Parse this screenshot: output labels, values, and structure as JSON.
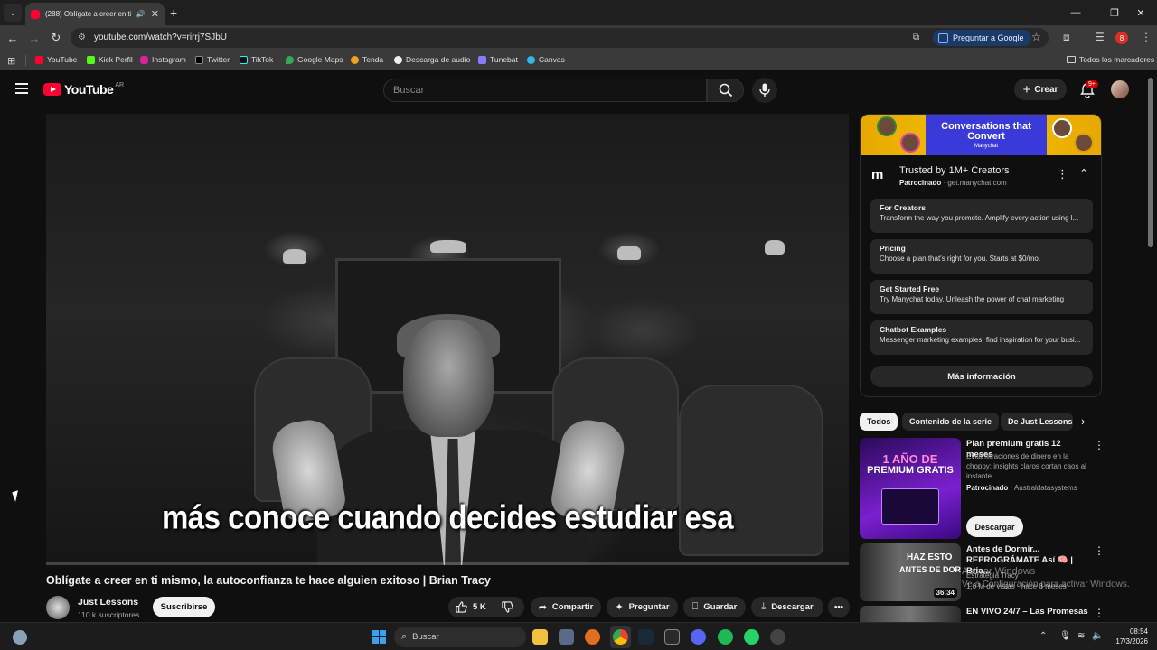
{
  "browser": {
    "tab_title": "(288) Oblígate a creer en ti",
    "url": "youtube.com/watch?v=rirrj7SJbU",
    "ask_google": "Preguntar a Google",
    "profile_initial": "8",
    "bookmarks": [
      "YouTube",
      "Kick Perfil",
      "Instagram",
      "Twitter",
      "TikTok",
      "Google Maps",
      "Tenda",
      "Descarga de audio",
      "Tunebat",
      "Canvas"
    ],
    "all_bookmarks": "Todos los marcadores"
  },
  "youtube": {
    "logo_text": "YouTube",
    "region": "AR",
    "search_placeholder": "Buscar",
    "create_label": "Crear",
    "notifications_badge": "9+",
    "brand_color": "#ff0033"
  },
  "video": {
    "caption": "más conoce cuando decides estudiar esa",
    "title": "Oblígate a creer en ti mismo, la autoconfianza te hace alguien exitoso | Brian Tracy",
    "progress_fraction": 0.0,
    "channel": {
      "name": "Just Lessons",
      "subscribers": "110 k suscriptores",
      "subscribe_label": "Suscribirse"
    },
    "actions": {
      "likes": "5 K",
      "share": "Compartir",
      "ask": "Preguntar",
      "save": "Guardar",
      "download": "Descargar"
    }
  },
  "ad": {
    "banner_title": "Conversations that Convert",
    "banner_brand": "Manychat",
    "title": "Trusted by 1M+ Creators",
    "sponsored": "Patrocinado",
    "domain": "get.manychat.com",
    "links": [
      {
        "title": "For Creators",
        "desc": "Transform the way you promote. Amplify every action using l..."
      },
      {
        "title": "Pricing",
        "desc": "Choose a plan that's right for you. Starts at $0/mo."
      },
      {
        "title": "Get Started Free",
        "desc": "Try Manychat today. Unleash the power of chat marketing"
      },
      {
        "title": "Chatbot Examples",
        "desc": "Messenger marketing examples. find inspiration for your busi..."
      }
    ],
    "cta": "Más información"
  },
  "chips": [
    "Todos",
    "Contenido de la serie",
    "De Just Lessons"
  ],
  "recommended": [
    {
      "title": "Plan premium gratis 12 meses",
      "desc": "Evita filtraciones de dinero en la choppy; insights claros cortan caos al instante.",
      "sponsored": "Patrocinado",
      "advertiser": "Australdatasystems",
      "thumb_line1": "1 AÑO DE",
      "thumb_line2": "PREMIUM GRATIS",
      "download_label": "Descargar"
    },
    {
      "title": "Antes de Dormir... REPROGRÁMATE Así 🧠 | Bria...",
      "channel": "Estrategia Tracy",
      "meta": "1,6 M de vistas · hace 8 meses",
      "thumb_line1": "HAZ ESTO",
      "thumb_line2": "ANTES DE DORMIR",
      "duration": "36:34"
    },
    {
      "title": "EN VIVO 24/7 – Las Promesas"
    }
  ],
  "watermark": {
    "line1": "Activar Windows",
    "line2": "Ve a Configuración para activar Windows."
  },
  "taskbar": {
    "search_placeholder": "Buscar",
    "time": "08:54",
    "date": "17/3/2026"
  }
}
